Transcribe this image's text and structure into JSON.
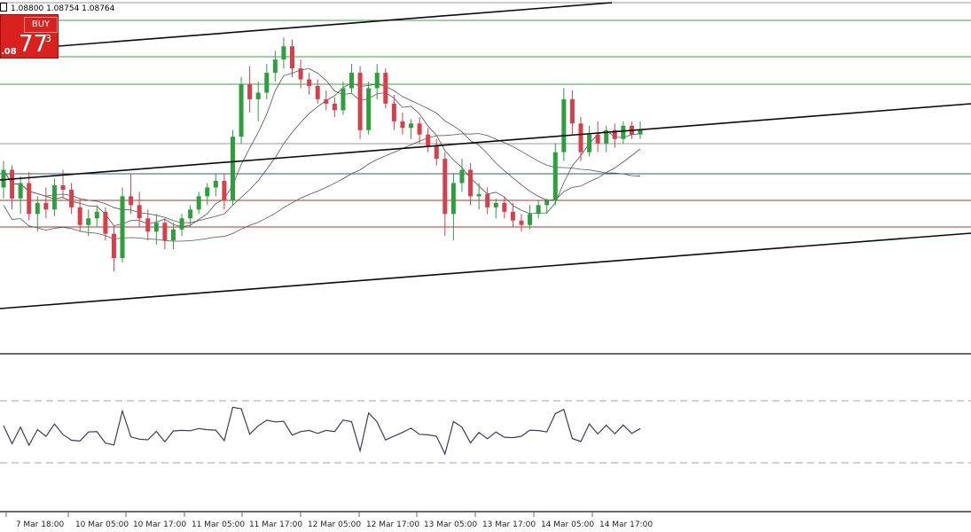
{
  "toolbar": {
    "ohlc_text": "1.08800 1.08754 1.08764"
  },
  "trade_panel": {
    "buy_label": "BUY",
    "price_prefix": ".08",
    "price_big": "77",
    "price_sup": "3"
  },
  "chart_data": {
    "type": "candlestick",
    "instrument_values_note": "",
    "x_ticks": [
      "7 Mar 18:00",
      "10 Mar 05:00",
      "10 Mar 17:00",
      "11 Mar 05:00",
      "11 Mar 17:00",
      "12 Mar 05:00",
      "12 Mar 17:00",
      "13 Mar 05:00",
      "13 Mar 17:00",
      "14 Mar 05:00",
      "14 Mar 17:00"
    ],
    "last_close": 1.08764,
    "candles": [
      [
        1.085,
        1.0862,
        1.0845,
        1.0858
      ],
      [
        1.0858,
        1.086,
        1.084,
        1.0845
      ],
      [
        1.0845,
        1.0855,
        1.0838,
        1.0852
      ],
      [
        1.0852,
        1.0857,
        1.0835,
        1.0838
      ],
      [
        1.0838,
        1.0846,
        1.083,
        1.0843
      ],
      [
        1.0843,
        1.085,
        1.0836,
        1.084
      ],
      [
        1.084,
        1.0854,
        1.0837,
        1.0851
      ],
      [
        1.0851,
        1.0858,
        1.0845,
        1.0849
      ],
      [
        1.0849,
        1.0852,
        1.0838,
        1.0841
      ],
      [
        1.0841,
        1.0845,
        1.083,
        1.0833
      ],
      [
        1.0833,
        1.084,
        1.0828,
        1.0836
      ],
      [
        1.0836,
        1.0842,
        1.0832,
        1.0839
      ],
      [
        1.0839,
        1.0841,
        1.0826,
        1.0829
      ],
      [
        1.0829,
        1.0833,
        1.0812,
        1.0818
      ],
      [
        1.0818,
        1.085,
        1.0816,
        1.0846
      ],
      [
        1.0846,
        1.0856,
        1.0838,
        1.0842
      ],
      [
        1.0842,
        1.0848,
        1.0832,
        1.0836
      ],
      [
        1.0836,
        1.084,
        1.0826,
        1.083
      ],
      [
        1.083,
        1.0838,
        1.0824,
        1.0834
      ],
      [
        1.0834,
        1.0836,
        1.0822,
        1.0826
      ],
      [
        1.0826,
        1.0834,
        1.0822,
        1.0831
      ],
      [
        1.0831,
        1.0838,
        1.0828,
        1.0836
      ],
      [
        1.0836,
        1.0842,
        1.0832,
        1.084
      ],
      [
        1.084,
        1.0848,
        1.0838,
        1.0846
      ],
      [
        1.0846,
        1.0852,
        1.0842,
        1.085
      ],
      [
        1.085,
        1.0856,
        1.0846,
        1.0853
      ],
      [
        1.0853,
        1.0856,
        1.084,
        1.0844
      ],
      [
        1.0844,
        1.0876,
        1.0842,
        1.0873
      ],
      [
        1.0873,
        1.09,
        1.087,
        1.0897
      ],
      [
        1.0897,
        1.0905,
        1.0884,
        1.089
      ],
      [
        1.089,
        1.0898,
        1.088,
        1.0893
      ],
      [
        1.0893,
        1.0906,
        1.089,
        1.0902
      ],
      [
        1.0902,
        1.0912,
        1.0898,
        1.0908
      ],
      [
        1.0908,
        1.0918,
        1.0904,
        1.0914
      ],
      [
        1.0914,
        1.0917,
        1.09,
        1.0904
      ],
      [
        1.0904,
        1.0908,
        1.0895,
        1.0899
      ],
      [
        1.0899,
        1.0902,
        1.0892,
        1.0896
      ],
      [
        1.0896,
        1.0899,
        1.0888,
        1.089
      ],
      [
        1.089,
        1.0894,
        1.0885,
        1.0888
      ],
      [
        1.0888,
        1.0891,
        1.0882,
        1.0885
      ],
      [
        1.0885,
        1.0898,
        1.0883,
        1.0895
      ],
      [
        1.0895,
        1.0906,
        1.0893,
        1.0902
      ],
      [
        1.0902,
        1.0905,
        1.0872,
        1.0876
      ],
      [
        1.0876,
        1.0898,
        1.0874,
        1.0895
      ],
      [
        1.0895,
        1.0906,
        1.089,
        1.0902
      ],
      [
        1.0902,
        1.0904,
        1.0886,
        1.0888
      ],
      [
        1.0888,
        1.0892,
        1.0876,
        1.088
      ],
      [
        1.088,
        1.0884,
        1.0874,
        1.0877
      ],
      [
        1.0877,
        1.0881,
        1.0872,
        1.0879
      ],
      [
        1.0879,
        1.0882,
        1.087,
        1.0874
      ],
      [
        1.0874,
        1.0877,
        1.0866,
        1.0869
      ],
      [
        1.0869,
        1.0872,
        1.086,
        1.0863
      ],
      [
        1.0863,
        1.0866,
        1.0828,
        1.0838
      ],
      [
        1.0838,
        1.0856,
        1.0826,
        1.0852
      ],
      [
        1.0852,
        1.0863,
        1.0848,
        1.0858
      ],
      [
        1.0858,
        1.0861,
        1.0842,
        1.0846
      ],
      [
        1.0846,
        1.0852,
        1.084,
        1.0847
      ],
      [
        1.0847,
        1.085,
        1.0838,
        1.0841
      ],
      [
        1.0841,
        1.0845,
        1.0836,
        1.0843
      ],
      [
        1.0843,
        1.0846,
        1.0836,
        1.0839
      ],
      [
        1.0839,
        1.0843,
        1.0832,
        1.0835
      ],
      [
        1.0835,
        1.0838,
        1.083,
        1.0833
      ],
      [
        1.0833,
        1.0842,
        1.0831,
        1.0838
      ],
      [
        1.0838,
        1.0844,
        1.0836,
        1.0842
      ],
      [
        1.0842,
        1.0845,
        1.0838,
        1.0844
      ],
      [
        1.0844,
        1.087,
        1.0842,
        1.0866
      ],
      [
        1.0866,
        1.0895,
        1.0862,
        1.089
      ],
      [
        1.089,
        1.0894,
        1.0874,
        1.0879
      ],
      [
        1.0879,
        1.0882,
        1.0862,
        1.0866
      ],
      [
        1.0866,
        1.0878,
        1.0864,
        1.0874
      ],
      [
        1.0874,
        1.088,
        1.0866,
        1.087
      ],
      [
        1.087,
        1.0878,
        1.0866,
        1.0876
      ],
      [
        1.0876,
        1.0879,
        1.0868,
        1.0872
      ],
      [
        1.0872,
        1.088,
        1.087,
        1.0878
      ],
      [
        1.0878,
        1.088,
        1.0872,
        1.0874
      ],
      [
        1.0874,
        1.088,
        1.0872,
        1.0876
      ]
    ],
    "moving_averages_present": 3,
    "horizontal_levels_present": true,
    "trendlines_present": 3,
    "oscillator": {
      "present": true,
      "upper_level_dashed": true,
      "lower_level_dashed": true
    },
    "colors": {
      "bull_candle": "#2e9e3e",
      "bear_candle": "#d6404a",
      "green_levels": "#3aa63a",
      "red_levels": "#b5322f",
      "blue_level": "#2a5d8f",
      "grey_level": "#9a9a9a",
      "trendline": "#0a0a0a",
      "ma": "#555555",
      "oscillator_line": "#3d3d5c",
      "oscillator_levels": "#a79ccc"
    }
  }
}
